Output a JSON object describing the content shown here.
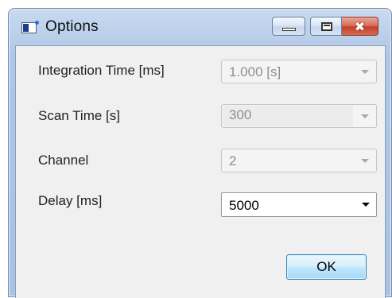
{
  "window": {
    "title": "Options",
    "icon": "application-window-icon",
    "buttons": {
      "minimize": "minimize-icon",
      "maximize": "maximize-icon",
      "close": "✖"
    }
  },
  "form": {
    "integration_time": {
      "label": "Integration Time [ms]",
      "value": "1.000 [s]",
      "enabled": false
    },
    "scan_time": {
      "label": "Scan Time [s]",
      "value": "300",
      "enabled": false
    },
    "channel": {
      "label": "Channel",
      "value": "2",
      "enabled": false
    },
    "delay": {
      "label": "Delay [ms]",
      "value": "5000",
      "enabled": true
    }
  },
  "ok_label": "OK",
  "colors": {
    "title_bar": "#b8cde9",
    "client": "#f0f0f0",
    "close_button": "#c4412a",
    "ok_button": "#bee6fd"
  }
}
